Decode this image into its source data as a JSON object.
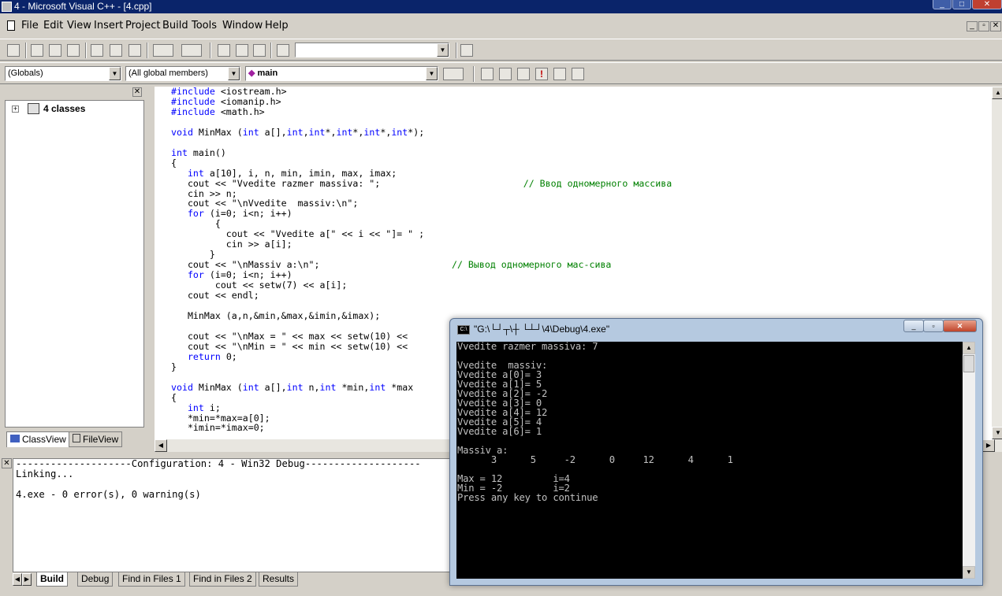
{
  "window": {
    "title": "4 - Microsoft Visual C++ - [4.cpp]"
  },
  "menu": [
    "File",
    "Edit",
    "View",
    "Insert",
    "Project",
    "Build",
    "Tools",
    "Window",
    "Help"
  ],
  "combos": {
    "globals": "(Globals)",
    "members": "(All global members)",
    "function": "main",
    "find": ""
  },
  "classview": {
    "root": "4 classes",
    "tabs": [
      "ClassView",
      "FileView"
    ]
  },
  "editor": {
    "lines": [
      "#include <iostream.h>",
      "#include <iomanip.h>",
      "#include <math.h>",
      "",
      "void MinMax (int a[],int,int*,int*,int*,int*);",
      "",
      "int main()",
      "{",
      "   int a[10], i, n, min, imin, max, imax;",
      "   cout << \"Vvedite razmer massiva: \";                          // Ввод одномерного массива",
      "   cin >> n;",
      "   cout << \"\\nVvedite  massiv:\\n\";",
      "   for (i=0; i<n; i++)",
      "        {",
      "          cout << \"Vvedite a[\" << i << \"]= \" ;",
      "          cin >> a[i];",
      "       }",
      "   cout << \"\\nMassiv a:\\n\";                        // Вывод одномерного мас-сива",
      "   for (i=0; i<n; i++)",
      "        cout << setw(7) << a[i];",
      "   cout << endl;",
      "",
      "   MinMax (a,n,&min,&max,&imin,&imax);",
      "",
      "   cout << \"\\nMax = \" << max << setw(10) <<",
      "   cout << \"\\nMin = \" << min << setw(10) <<",
      "   return 0;",
      "}",
      "",
      "void MinMax (int a[],int n,int *min,int *max",
      "{",
      "   int i;",
      "   *min=*max=a[0];",
      "   *imin=*imax=0;"
    ]
  },
  "output": {
    "lines": [
      "--------------------Configuration: 4 - Win32 Debug--------------------",
      "Linking...",
      "",
      "4.exe - 0 error(s), 0 warning(s)"
    ],
    "tabs": [
      "Build",
      "Debug",
      "Find in Files 1",
      "Find in Files 2",
      "Results"
    ]
  },
  "console": {
    "title": "\"G:\\└┘┬\\┼ └┴┘\\4\\Debug\\4.exe\"",
    "lines": [
      "Vvedite razmer massiva: 7",
      "",
      "Vvedite  massiv:",
      "Vvedite a[0]= 3",
      "Vvedite a[1]= 5",
      "Vvedite a[2]= -2",
      "Vvedite a[3]= 0",
      "Vvedite a[4]= 12",
      "Vvedite a[5]= 4",
      "Vvedite a[6]= 1",
      "",
      "Massiv a:",
      "      3      5     -2      0     12      4      1",
      "",
      "Max = 12         i=4",
      "Min = -2         i=2",
      "Press any key to continue"
    ]
  },
  "colors": {
    "titlebar": "#0a246a",
    "keyword": "#0000ff",
    "comment": "#008000",
    "console_bg": "#000000",
    "console_fg": "#c0c0c0"
  }
}
